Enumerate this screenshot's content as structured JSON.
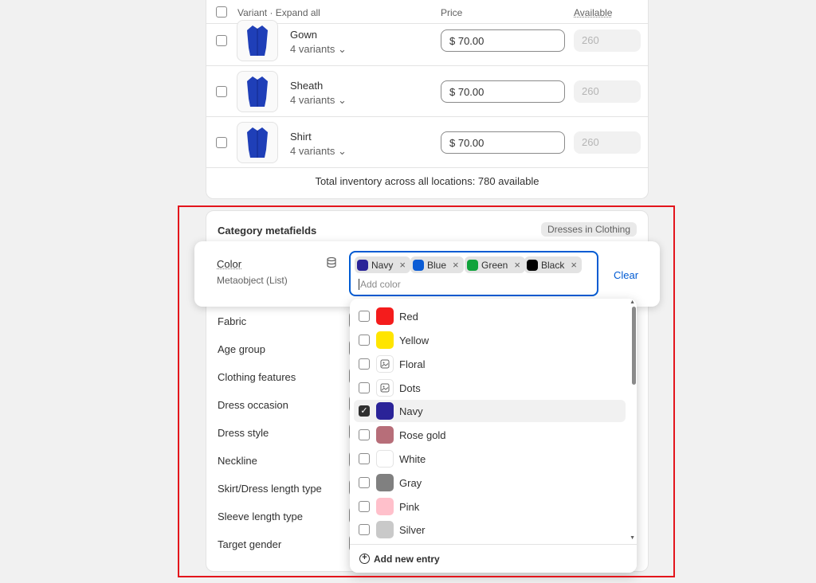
{
  "variants": {
    "header": {
      "variant_label": "Variant · Expand all",
      "price_label": "Price",
      "available_label": "Available"
    },
    "rows": [
      {
        "name": "Gown",
        "count": "4 variants",
        "price": "$ 70.00",
        "available": "260"
      },
      {
        "name": "Sheath",
        "count": "4 variants",
        "price": "$ 70.00",
        "available": "260"
      },
      {
        "name": "Shirt",
        "count": "4 variants",
        "price": "$ 70.00",
        "available": "260"
      }
    ],
    "total": "Total inventory across all locations: 780 available"
  },
  "category": {
    "title": "Category metafields",
    "badge": "Dresses in Clothing",
    "fields": [
      "Fabric",
      "Age group",
      "Clothing features",
      "Dress occasion",
      "Dress style",
      "Neckline",
      "Skirt/Dress length type",
      "Sleeve length type",
      "Target gender"
    ]
  },
  "color_field": {
    "label": "Color",
    "type": "Metaobject (List)",
    "placeholder": "Add color",
    "clear": "Clear",
    "tags": [
      {
        "label": "Navy",
        "color": "#2a2398"
      },
      {
        "label": "Blue",
        "color": "#0b5cd5"
      },
      {
        "label": "Green",
        "color": "#10a33b"
      },
      {
        "label": "Black",
        "color": "#000000"
      }
    ]
  },
  "dropdown": {
    "options": [
      {
        "label": "Red",
        "color": "#f41c1c",
        "checked": false,
        "icon": ""
      },
      {
        "label": "Yellow",
        "color": "#ffe500",
        "checked": false,
        "icon": ""
      },
      {
        "label": "Floral",
        "color": "#ffffff",
        "checked": false,
        "icon": "image-icon"
      },
      {
        "label": "Dots",
        "color": "#ffffff",
        "checked": false,
        "icon": "image-icon"
      },
      {
        "label": "Navy",
        "color": "#2a2398",
        "checked": true,
        "icon": ""
      },
      {
        "label": "Rose gold",
        "color": "#b76e79",
        "checked": false,
        "icon": ""
      },
      {
        "label": "White",
        "color": "#ffffff",
        "checked": false,
        "icon": ""
      },
      {
        "label": "Gray",
        "color": "#808080",
        "checked": false,
        "icon": ""
      },
      {
        "label": "Pink",
        "color": "#ffc0cb",
        "checked": false,
        "icon": ""
      },
      {
        "label": "Silver",
        "color": "#c9c9c9",
        "checked": false,
        "icon": ""
      }
    ],
    "add_new": "Add new entry"
  }
}
